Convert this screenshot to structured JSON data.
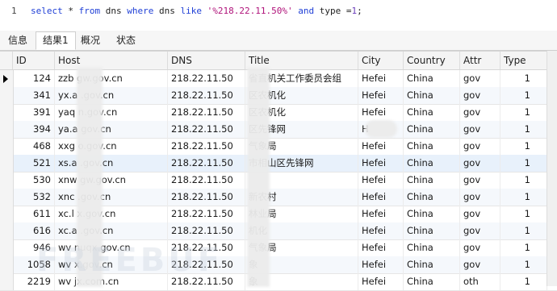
{
  "editor": {
    "line_number": "1",
    "sql": [
      {
        "t": "select",
        "c": "kw"
      },
      {
        "t": " * ",
        "c": "plain"
      },
      {
        "t": "from",
        "c": "kw"
      },
      {
        "t": " dns ",
        "c": "plain"
      },
      {
        "t": "where",
        "c": "kw"
      },
      {
        "t": " dns ",
        "c": "plain"
      },
      {
        "t": "like",
        "c": "kw"
      },
      {
        "t": " ",
        "c": "plain"
      },
      {
        "t": "'%218.22.11.50%'",
        "c": "str"
      },
      {
        "t": " ",
        "c": "plain"
      },
      {
        "t": "and",
        "c": "kw"
      },
      {
        "t": " type =",
        "c": "plain"
      },
      {
        "t": "1",
        "c": "num"
      },
      {
        "t": ";",
        "c": "plain"
      }
    ]
  },
  "tabs": [
    {
      "label": "信息",
      "active": false
    },
    {
      "label": "结果1",
      "active": true
    },
    {
      "label": "概况",
      "active": false
    },
    {
      "label": "状态",
      "active": false
    }
  ],
  "table": {
    "headers": [
      "ID",
      "Host",
      "DNS",
      "Title",
      "City",
      "Country",
      "Attr",
      "Type"
    ],
    "rows": [
      {
        "id": "124",
        "host": "zzb        gw.gov.cn",
        "dns": "218.22.11.50",
        "title": "       省直机关工作委员会组",
        "city": "Hefei",
        "country": "China",
        "attr": "gov",
        "type": "1"
      },
      {
        "id": "341",
        "host": "yx.a        .gov.cn",
        "dns": "218.22.11.50",
        "title": "       区农机化",
        "city": "Hefei",
        "country": "China",
        "attr": "gov",
        "type": "1"
      },
      {
        "id": "391",
        "host": "yaq        n.gov.cn",
        "dns": "218.22.11.50",
        "title": "       区农机化",
        "city": "Hefei",
        "country": "China",
        "attr": "gov",
        "type": "1"
      },
      {
        "id": "394",
        "host": "ya.a        gov.cn",
        "dns": "218.22.11.50",
        "title": "       区先锋网",
        "city": "H",
        "country": "China",
        "attr": "gov",
        "type": "1"
      },
      {
        "id": "468",
        "host": "xxg        o.gov.cn",
        "dns": "218.22.11.50",
        "title": "       气象局",
        "city": "Hefei",
        "country": "China",
        "attr": "gov",
        "type": "1"
      },
      {
        "id": "521",
        "host": "xs.a        .gov.cn",
        "dns": "218.22.11.50",
        "title": "       市相山区先锋网",
        "city": "Hefei",
        "country": "China",
        "attr": "gov",
        "type": "1"
      },
      {
        "id": "530",
        "host": "xnw        gw.gov.cn",
        "dns": "218.22.11.50",
        "title": "",
        "city": "Hefei",
        "country": "China",
        "attr": "gov",
        "type": "1"
      },
      {
        "id": "532",
        "host": "xnc        .gov.cn",
        "dns": "218.22.11.50",
        "title": "       新农村",
        "city": "Hefei",
        "country": "China",
        "attr": "gov",
        "type": "1"
      },
      {
        "id": "611",
        "host": "xc.l        x.gov.cn",
        "dns": "218.22.11.50",
        "title": "       林业局",
        "city": "Hefei",
        "country": "China",
        "attr": "gov",
        "type": "1"
      },
      {
        "id": "616",
        "host": "xc.a        .gov.cn",
        "dns": "218.22.11.50",
        "title": "       机化",
        "city": "Hefei",
        "country": "China",
        "attr": "gov",
        "type": "1"
      },
      {
        "id": "946",
        "host": "wv        nuqx.gov.cn",
        "dns": "218.22.11.50",
        "title": "       气象局",
        "city": "Hefei",
        "country": "China",
        "attr": "gov",
        "type": "1"
      },
      {
        "id": "1058",
        "host": "wv        x.gov.cn",
        "dns": "218.22.11.50",
        "title": "       象",
        "city": "Hefei",
        "country": "China",
        "attr": "gov",
        "type": "1"
      },
      {
        "id": "2219",
        "host": "wv        jx.com.cn",
        "dns": "218.22.11.50",
        "title": "       象",
        "city": "Hefei",
        "country": "China",
        "attr": "oth",
        "type": "1"
      }
    ]
  },
  "watermark": "FREEBUF"
}
